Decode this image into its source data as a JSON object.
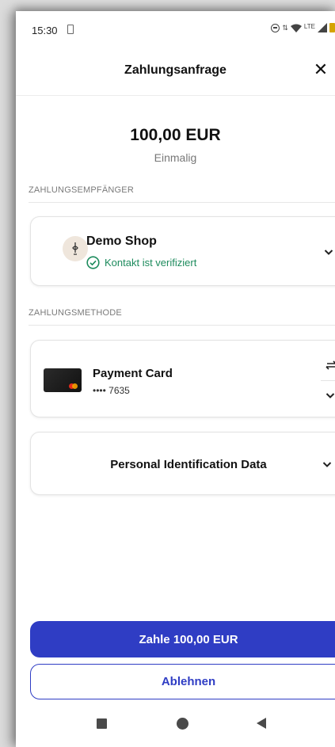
{
  "status_bar": {
    "time": "15:30",
    "network": "LTE"
  },
  "header": {
    "title": "Zahlungsanfrage",
    "close_glyph": "✕"
  },
  "summary": {
    "amount": "100,00 EUR",
    "frequency": "Einmalig"
  },
  "payee": {
    "section_label": "ZAHLUNGSEMPFÄNGER",
    "name": "Demo Shop",
    "verified_text": "Kontakt ist verifiziert",
    "verified_color": "#1d8b5d"
  },
  "payment_method": {
    "section_label": "ZAHLUNGSMETHODE",
    "card_name": "Payment Card",
    "card_number": "•••• 7635"
  },
  "personal_data": {
    "label": "Personal Identification Data"
  },
  "actions": {
    "pay_label": "Zahle 100,00 EUR",
    "decline_label": "Ablehnen",
    "accent_color": "#2f3dc4"
  },
  "icons": [
    "sim-card-icon",
    "do-not-disturb-icon",
    "wifi-icon",
    "signal-icon",
    "battery-icon",
    "close-icon",
    "shop-logo-icon",
    "check-circle-icon",
    "chevron-down-icon",
    "swap-icon",
    "card-icon",
    "recents-icon",
    "home-icon",
    "back-icon"
  ]
}
